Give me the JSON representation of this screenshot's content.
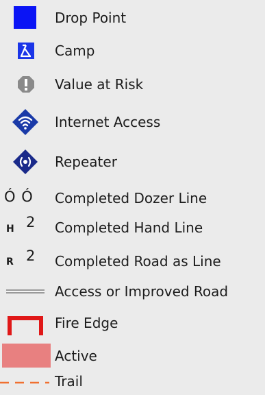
{
  "colors": {
    "drop_point": "#0a14f5",
    "camp": "#1a35e8",
    "value_at_risk": "#8a8a8a",
    "internet_access": "#1a3aa8",
    "repeater": "#1a2a8a",
    "fire_edge": "#e01818",
    "active": "#e88080",
    "trail": "#f07030",
    "road": "#9a9a9a",
    "background": "#ebebeb"
  },
  "legend": {
    "items": [
      {
        "icon": "drop-point-square-icon",
        "label": "Drop Point"
      },
      {
        "icon": "camp-tent-icon",
        "label": "Camp"
      },
      {
        "icon": "value-at-risk-octagon-icon",
        "label": "Value at Risk"
      },
      {
        "icon": "internet-access-wifi-icon",
        "label": "Internet Access"
      },
      {
        "icon": "repeater-radio-icon",
        "label": "Repeater"
      },
      {
        "icon": "dozer-line-icon",
        "symbol": "Ó Ó",
        "label": "Completed Dozer Line"
      },
      {
        "icon": "hand-line-icon",
        "symbol_letter": "H",
        "symbol_mark": "2",
        "label": "Completed Hand Line"
      },
      {
        "icon": "road-as-line-icon",
        "symbol_letter": "R",
        "symbol_mark": "2",
        "label": "Completed Road as Line"
      },
      {
        "icon": "access-road-icon",
        "label": "Access or Improved Road"
      },
      {
        "icon": "fire-edge-icon",
        "label": "Fire Edge"
      },
      {
        "icon": "active-fire-icon",
        "label": "Active"
      },
      {
        "icon": "trail-dashed-icon",
        "label": "Trail"
      }
    ]
  }
}
